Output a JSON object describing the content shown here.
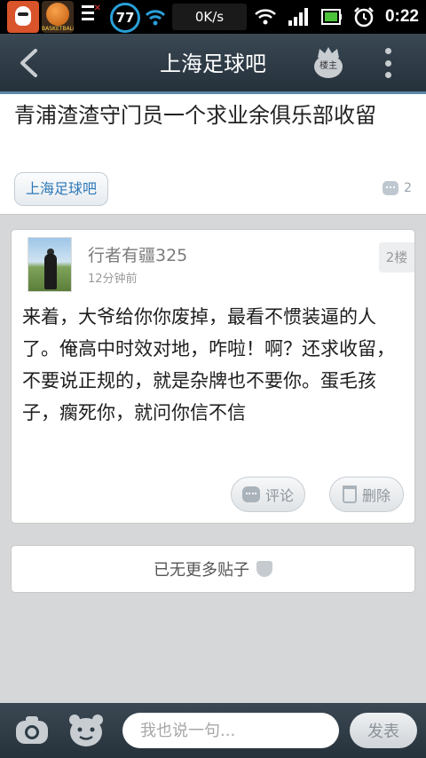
{
  "status_bar": {
    "basketball_app_text": "BASKETBALL",
    "battery_circle": "77",
    "net_speed": "0K/s",
    "time": "0:22"
  },
  "title_bar": {
    "title": "上海足球吧",
    "owner_badge": "楼主"
  },
  "thread": {
    "title": "青浦渣渣守门员一个求业余俱乐部收留",
    "forum_tag": "上海足球吧",
    "reply_count": "2"
  },
  "floor": {
    "author": "行者有疆325",
    "time": "12分钟前",
    "floor_number": "2楼",
    "content": "来着，大爷给你你废掉，最看不惯装逼的人了。俺高中时效对地，咋啦！啊？还求收留，不要说正规的，就是杂牌也不要你。蛋毛孩子，瘸死你，就问你信不信",
    "comment_label": "评论",
    "delete_label": "删除"
  },
  "no_more": {
    "label": "已无更多贴子"
  },
  "bottom_bar": {
    "input_placeholder": "我也说一句...",
    "send_label": "发表"
  },
  "colors": {
    "title_bar": "#2f3c46",
    "accent_line": "#5b86a8",
    "link_blue": "#2f79b8",
    "background": "#d6d7d9"
  },
  "icons": [
    "qq-icon",
    "basketball-app-icon",
    "notification-icon",
    "wifi-icon",
    "signal-icon",
    "battery-icon",
    "alarm-icon",
    "back-icon",
    "owner-crown-icon",
    "more-vertical-icon",
    "comment-bubble-icon",
    "trash-icon",
    "shield-icon",
    "camera-icon",
    "emoji-icon"
  ]
}
